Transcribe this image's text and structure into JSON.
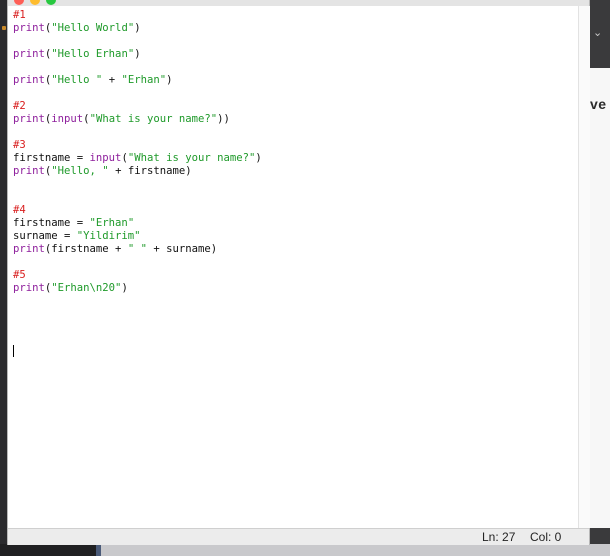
{
  "background_app": {
    "partial_text": "ve"
  },
  "editor": {
    "lines": [
      {
        "kind": "comment",
        "text": "#1"
      },
      {
        "kind": "code",
        "segments": [
          {
            "type": "keyword",
            "text": "print"
          },
          {
            "type": "text",
            "text": "("
          },
          {
            "type": "string",
            "text": "\"Hello World\""
          },
          {
            "type": "text",
            "text": ")"
          }
        ]
      },
      {
        "kind": "blank"
      },
      {
        "kind": "code",
        "segments": [
          {
            "type": "keyword",
            "text": "print"
          },
          {
            "type": "text",
            "text": "("
          },
          {
            "type": "string",
            "text": "\"Hello Erhan\""
          },
          {
            "type": "text",
            "text": ")"
          }
        ]
      },
      {
        "kind": "blank"
      },
      {
        "kind": "code",
        "segments": [
          {
            "type": "keyword",
            "text": "print"
          },
          {
            "type": "text",
            "text": "("
          },
          {
            "type": "string",
            "text": "\"Hello \""
          },
          {
            "type": "text",
            "text": " + "
          },
          {
            "type": "string",
            "text": "\"Erhan\""
          },
          {
            "type": "text",
            "text": ")"
          }
        ]
      },
      {
        "kind": "blank"
      },
      {
        "kind": "comment",
        "text": "#2"
      },
      {
        "kind": "code",
        "segments": [
          {
            "type": "keyword",
            "text": "print"
          },
          {
            "type": "text",
            "text": "("
          },
          {
            "type": "keyword",
            "text": "input"
          },
          {
            "type": "text",
            "text": "("
          },
          {
            "type": "string",
            "text": "\"What is your name?\""
          },
          {
            "type": "text",
            "text": "))"
          }
        ]
      },
      {
        "kind": "blank"
      },
      {
        "kind": "comment",
        "text": "#3"
      },
      {
        "kind": "code",
        "segments": [
          {
            "type": "text",
            "text": "firstname = "
          },
          {
            "type": "keyword",
            "text": "input"
          },
          {
            "type": "text",
            "text": "("
          },
          {
            "type": "string",
            "text": "\"What is your name?\""
          },
          {
            "type": "text",
            "text": ")"
          }
        ]
      },
      {
        "kind": "code",
        "segments": [
          {
            "type": "keyword",
            "text": "print"
          },
          {
            "type": "text",
            "text": "("
          },
          {
            "type": "string",
            "text": "\"Hello, \""
          },
          {
            "type": "text",
            "text": " + firstname)"
          }
        ]
      },
      {
        "kind": "blank"
      },
      {
        "kind": "blank"
      },
      {
        "kind": "comment",
        "text": "#4"
      },
      {
        "kind": "code",
        "segments": [
          {
            "type": "text",
            "text": "firstname = "
          },
          {
            "type": "string",
            "text": "\"Erhan\""
          }
        ]
      },
      {
        "kind": "code",
        "segments": [
          {
            "type": "text",
            "text": "surname = "
          },
          {
            "type": "string",
            "text": "\"Yildirim\""
          }
        ]
      },
      {
        "kind": "code",
        "segments": [
          {
            "type": "keyword",
            "text": "print"
          },
          {
            "type": "text",
            "text": "(firstname + "
          },
          {
            "type": "string",
            "text": "\" \""
          },
          {
            "type": "text",
            "text": " + surname)"
          }
        ]
      },
      {
        "kind": "blank"
      },
      {
        "kind": "comment",
        "text": "#5"
      },
      {
        "kind": "code",
        "segments": [
          {
            "type": "keyword",
            "text": "print"
          },
          {
            "type": "text",
            "text": "("
          },
          {
            "type": "string",
            "text": "\"Erhan\\n20\""
          },
          {
            "type": "text",
            "text": ")"
          }
        ]
      }
    ]
  },
  "statusbar": {
    "ln": "Ln: 27",
    "col": "Col: 0"
  },
  "colors": {
    "keyword": "#8e1f9c",
    "string": "#1f9a2a",
    "comment": "#d91f1f",
    "text": "#111111"
  }
}
